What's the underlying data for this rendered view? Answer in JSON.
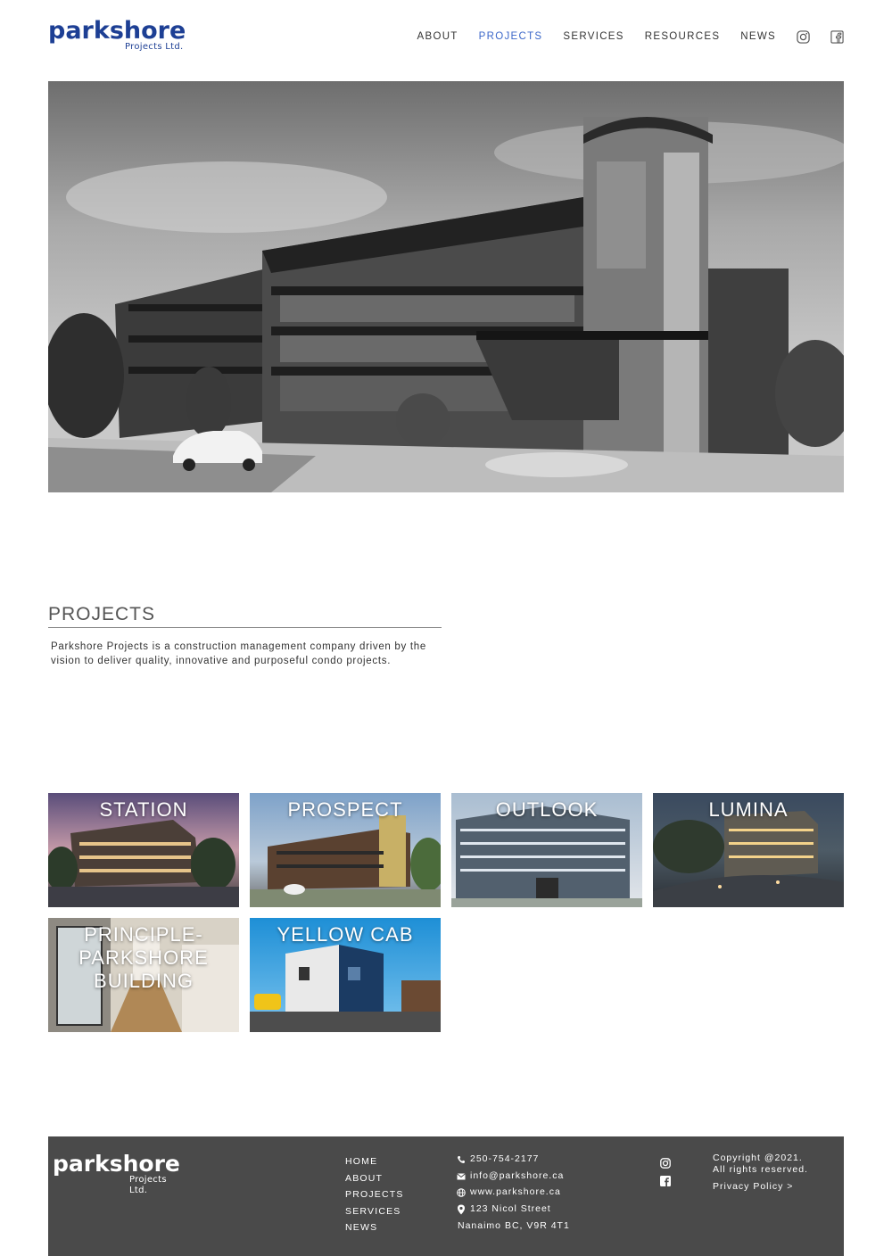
{
  "brand": {
    "name": "parkshore",
    "sub": "Projects Ltd.",
    "color": "#1d3f94"
  },
  "nav": {
    "items": [
      {
        "label": "ABOUT",
        "active": false
      },
      {
        "label": "PROJECTS",
        "active": true
      },
      {
        "label": "SERVICES",
        "active": false
      },
      {
        "label": "RESOURCES",
        "active": false
      },
      {
        "label": "NEWS",
        "active": false
      }
    ],
    "icons": [
      "instagram-icon",
      "facebook-icon"
    ],
    "active_color": "#3b67c9"
  },
  "hero": {
    "image": "grayscale-condo-building-rendering"
  },
  "projects_section": {
    "title": "PROJECTS",
    "description": "Parkshore Projects is a construction management company driven by the vision to deliver quality, innovative and purposeful condo projects."
  },
  "projects": [
    {
      "label": "STATION"
    },
    {
      "label": "PROSPECT"
    },
    {
      "label": "OUTLOOK"
    },
    {
      "label": "LUMINA"
    },
    {
      "label": "PRINCIPLE-\nPARKSHORE\nBUILDING"
    },
    {
      "label": "YELLOW CAB"
    }
  ],
  "footer": {
    "brand": {
      "name": "parkshore",
      "sub": "Projects Ltd."
    },
    "nav": [
      "HOME",
      "ABOUT",
      "PROJECTS",
      "SERVICES",
      "NEWS"
    ],
    "phone": "250-754-2177",
    "email": "info@parkshore.ca",
    "website": "www.parkshore.ca",
    "address_line1": "123 Nicol Street",
    "address_line2": "Nanaimo BC, V9R 4T1",
    "copyright_line1": "Copyright @2021.",
    "copyright_line2": "All rights reserved.",
    "privacy": "Privacy Policy >",
    "background": "#4a4a4a"
  }
}
